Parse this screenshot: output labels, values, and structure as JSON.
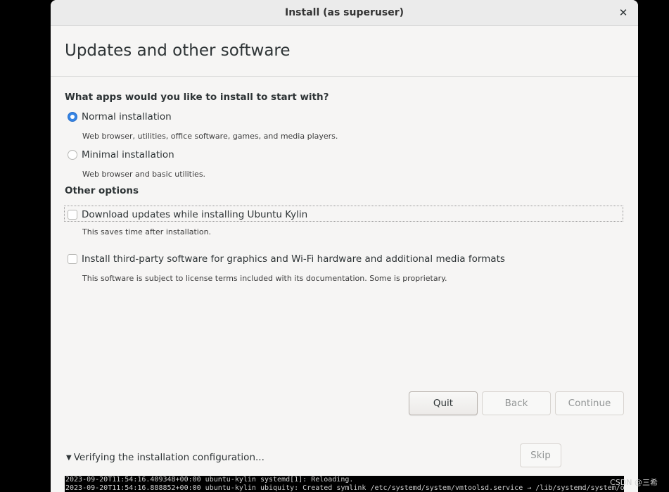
{
  "window": {
    "title": "Install (as superuser)",
    "close_glyph": "✕"
  },
  "page": {
    "title": "Updates and other software"
  },
  "install_type": {
    "question": "What apps would you like to install to start with?",
    "options": [
      {
        "label": "Normal installation",
        "description": "Web browser, utilities, office software, games, and media players.",
        "selected": true
      },
      {
        "label": "Minimal installation",
        "description": "Web browser and basic utilities.",
        "selected": false
      }
    ]
  },
  "other_options": {
    "heading": "Other options",
    "items": [
      {
        "label": "Download updates while installing Ubuntu Kylin",
        "description": "This saves time after installation.",
        "checked": false
      },
      {
        "label": "Install third-party software for graphics and Wi-Fi hardware and additional media formats",
        "description": "This software is subject to license terms included with its documentation. Some is proprietary.",
        "checked": false
      }
    ]
  },
  "buttons": {
    "quit": "Quit",
    "back": "Back",
    "continue": "Continue",
    "skip": "Skip"
  },
  "progress": {
    "expander_icon": "chevron-down-icon",
    "status": "Verifying the installation configuration..."
  },
  "log": {
    "lines": [
      "2023-09-20T11:54:16.409348+00:00 ubuntu-kylin systemd[1]: Reloading.",
      "2023-09-20T11:54:16.888852+00:00 ubuntu-kylin ubiquity: Created symlink /etc/systemd/system/vmtoolsd.service → /lib/systemd/system/o"
    ]
  },
  "watermark": "CSDN @三希",
  "colors": {
    "accent": "#3584e4",
    "background": "#f6f5f4",
    "titlebar": "#ebebeb",
    "desktop": "#000000"
  }
}
